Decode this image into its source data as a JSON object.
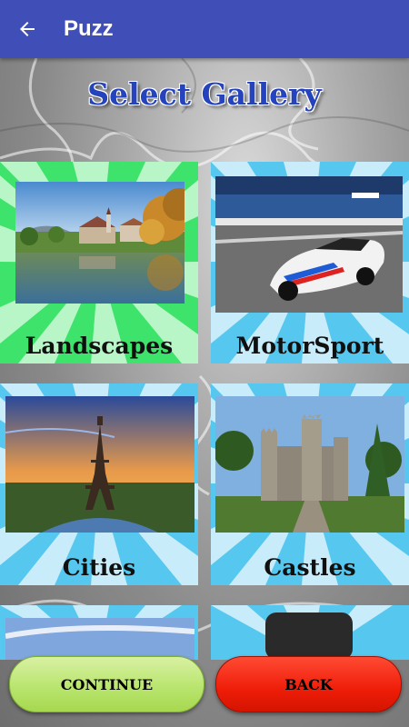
{
  "app_bar": {
    "title": "Puzz",
    "back_icon": "arrow-left-icon"
  },
  "heading": "Select Gallery",
  "galleries": [
    {
      "label": "Landscapes",
      "theme_color": "#3ee36b"
    },
    {
      "label": "MotorSport",
      "theme_color": "#56c8ef"
    },
    {
      "label": "Cities",
      "theme_color": "#56c8ef"
    },
    {
      "label": "Castles",
      "theme_color": "#56c8ef"
    },
    {
      "label": "",
      "theme_color": "#56c8ef"
    },
    {
      "label": "",
      "theme_color": "#56c8ef"
    }
  ],
  "buttons": {
    "continue_label": "CONTINUE",
    "back_label": "BACK"
  },
  "colors": {
    "app_bar": "#3f4fb7",
    "heading": "#2543bd",
    "continue": "#b9e56f",
    "back": "#ee1d09"
  }
}
